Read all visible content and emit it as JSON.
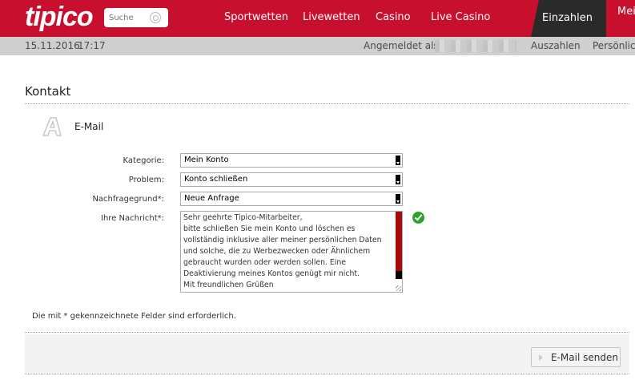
{
  "header": {
    "logo_text": "tipico",
    "search_placeholder": "Suche",
    "nav": [
      "Sportwetten",
      "Livewetten",
      "Casino",
      "Live Casino"
    ],
    "deposit_label": "Einzahlen",
    "menu_label": "Mei"
  },
  "subbar": {
    "date": "15.11.2016",
    "time": "17:17",
    "logged_in_label": "Angemeldet als:",
    "withdraw_label": "Auszahlen",
    "personal_label": "Persönlic"
  },
  "page": {
    "title": "Kontakt",
    "section_title": "E-Mail"
  },
  "form": {
    "category_label": "Kategorie:",
    "category_value": "Mein Konto",
    "problem_label": "Problem:",
    "problem_value": "Konto schließen",
    "reason_label": "Nachfragegrund*:",
    "reason_value": "Neue Anfrage",
    "message_label": "Ihre Nachricht*:",
    "message_value": "Sehr geehrte Tipico-Mitarbeiter,\nbitte schließen Sie mein Konto und löschen es vollständig inklusive aller meiner persönlichen Daten und solche, die zu Werbezwecken oder Ähnlichem gebraucht wurden oder werden sollen. Eine Deaktivierung meines Kontos genügt mir nicht.\nMit freundlichen Grüßen",
    "required_note": "Die mit * gekennzeichnete Felder sind erforderlich.",
    "send_label": "E-Mail senden"
  },
  "colors": {
    "brand": "#c8102e",
    "dark_tab": "#2a2a2a",
    "subbar": "#cfcfcf",
    "valid": "#2da02d"
  },
  "icons": [
    "search-icon",
    "contact-a-icon",
    "dropdown-arrow-icon",
    "check-icon",
    "send-arrow-icon"
  ]
}
